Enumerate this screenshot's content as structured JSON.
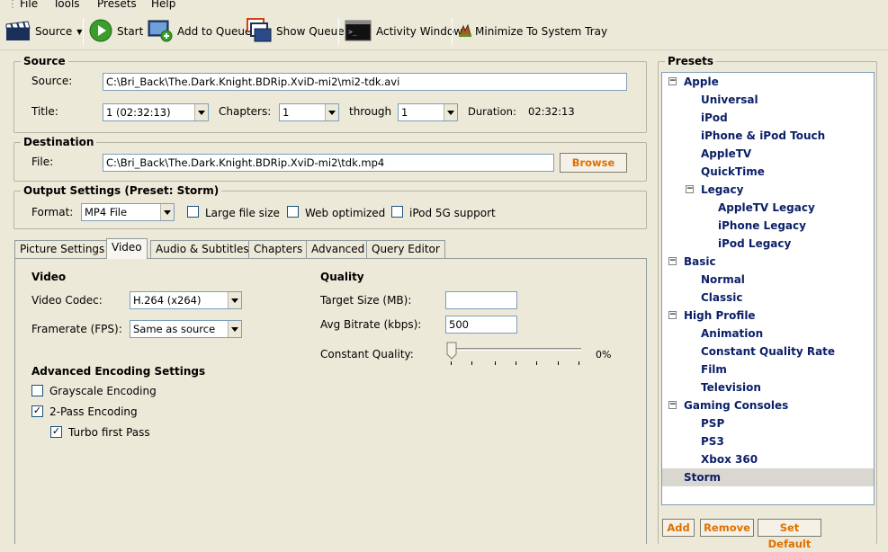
{
  "menu": [
    "File",
    "Tools",
    "Presets",
    "Help"
  ],
  "toolbar": {
    "source": "Source",
    "start": "Start",
    "add_to_queue": "Add to Queue",
    "show_queue": "Show Queue",
    "activity_window": "Activity Window",
    "minimize_tray": "Minimize To System Tray"
  },
  "source_group": {
    "title": "Source",
    "source_label": "Source:",
    "source_value": "C:\\Bri_Back\\The.Dark.Knight.BDRip.XviD-mi2\\mi2-tdk.avi",
    "title_label": "Title:",
    "title_value": "1 (02:32:13)",
    "chapters_label": "Chapters:",
    "chapter_from": "1",
    "through_label": "through",
    "chapter_to": "1",
    "duration_label": "Duration:",
    "duration_value": "02:32:13"
  },
  "destination": {
    "title": "Destination",
    "file_label": "File:",
    "file_value": "C:\\Bri_Back\\The.Dark.Knight.BDRip.XviD-mi2\\tdk.mp4",
    "browse": "Browse"
  },
  "output": {
    "title": "Output Settings (Preset: Storm)",
    "format_label": "Format:",
    "format_value": "MP4 File",
    "large_file": "Large file size",
    "web_optimized": "Web optimized",
    "ipod_5g": "iPod 5G support"
  },
  "tabs": [
    "Picture Settings",
    "Video",
    "Audio & Subtitles",
    "Chapters",
    "Advanced",
    "Query Editor"
  ],
  "video": {
    "heading": "Video",
    "codec_label": "Video Codec:",
    "codec_value": "H.264 (x264)",
    "framerate_label": "Framerate (FPS):",
    "framerate_value": "Same as source",
    "quality_heading": "Quality",
    "target_size_label": "Target Size (MB):",
    "target_size_value": "",
    "avg_bitrate_label": "Avg Bitrate (kbps):",
    "avg_bitrate_value": "500",
    "cq_label": "Constant Quality:",
    "cq_value": "0%",
    "adv_heading": "Advanced Encoding Settings",
    "grayscale": "Grayscale Encoding",
    "two_pass": "2-Pass Encoding",
    "turbo": "Turbo first Pass",
    "grayscale_checked": false,
    "two_pass_checked": true,
    "turbo_checked": true
  },
  "presets": {
    "title": "Presets",
    "items": [
      {
        "label": "Apple",
        "level": 0,
        "expander": "−"
      },
      {
        "label": "Universal",
        "level": 1
      },
      {
        "label": "iPod",
        "level": 1
      },
      {
        "label": "iPhone & iPod Touch",
        "level": 1
      },
      {
        "label": "AppleTV",
        "level": 1
      },
      {
        "label": "QuickTime",
        "level": 1
      },
      {
        "label": "Legacy",
        "level": 1,
        "expander": "−"
      },
      {
        "label": "AppleTV Legacy",
        "level": 2
      },
      {
        "label": "iPhone Legacy",
        "level": 2
      },
      {
        "label": "iPod Legacy",
        "level": 2
      },
      {
        "label": "Basic",
        "level": 0,
        "expander": "−"
      },
      {
        "label": "Normal",
        "level": 1
      },
      {
        "label": "Classic",
        "level": 1
      },
      {
        "label": "High Profile",
        "level": 0,
        "expander": "−"
      },
      {
        "label": "Animation",
        "level": 1
      },
      {
        "label": "Constant Quality Rate",
        "level": 1
      },
      {
        "label": "Film",
        "level": 1
      },
      {
        "label": "Television",
        "level": 1
      },
      {
        "label": "Gaming Consoles",
        "level": 0,
        "expander": "−"
      },
      {
        "label": "PSP",
        "level": 1
      },
      {
        "label": "PS3",
        "level": 1
      },
      {
        "label": "Xbox 360",
        "level": 1
      },
      {
        "label": "Storm",
        "level": 0,
        "selected": true
      }
    ],
    "add": "Add",
    "remove": "Remove",
    "set_default": "Set Default"
  }
}
